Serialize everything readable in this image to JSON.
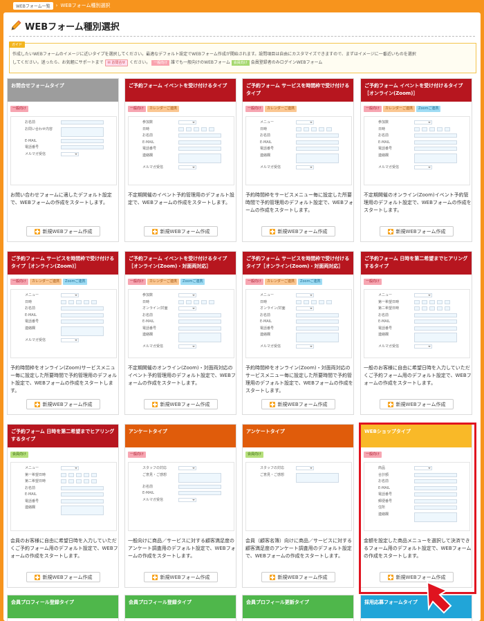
{
  "breadcrumb": {
    "home": "WEBフォーム一覧",
    "current": "WEBフォーム種別選択"
  },
  "page_title": "WEBフォーム種別選択",
  "guide": {
    "tag": "ガイド",
    "line1": "作成したいWEBフォームのイメージに近いタイプを選択してください。最適なデフォルト設定でWEBフォーム作成が開始されます。設問項目は自由にカスタマイズできますので、まずはイメージに一番近いものを選択",
    "line2a": "してください。迷ったら、お気軽にサポートまで",
    "contact_btn": "お問合せ",
    "line2b": "ください。",
    "tag_ippan": "一般向け",
    "line2c": "誰でも一般向けのWEBフォーム",
    "tag_kaiin": "会員向け",
    "line2d": "会員登録者のみログインWEBフォーム"
  },
  "new_btn_label": "新規WEBフォーム作成",
  "cards": [
    {
      "title": "お問合せフォームタイプ",
      "color": "#9d9d9d",
      "tags": [
        "一般向け"
      ],
      "fields": [
        [
          "お名前",
          "input"
        ],
        [
          "お問い合わせ内容",
          "box"
        ],
        [
          "E-MAIL",
          "input"
        ],
        [
          "電話番号",
          "input"
        ],
        [
          "メルマガ受信",
          "select"
        ]
      ],
      "desc": "お問い合わせフォームに適したデフォルト設定で、WEBフォームの作成をスタートします。"
    },
    {
      "title": "ご予約フォーム イベントを受け付けるタイプ",
      "color": "#b7161f",
      "tags": [
        "一般向け",
        "カレンダーご連携"
      ],
      "fields": [
        [
          "参加数",
          "select"
        ],
        [
          "日時",
          "date"
        ],
        [
          "お名前",
          "input"
        ],
        [
          "E-MAIL",
          "input"
        ],
        [
          "電話番号",
          "input"
        ],
        [
          "連絡欄",
          "box"
        ],
        [
          "メルマガ受信",
          "select"
        ]
      ],
      "desc": "不定期開催のイベント予約管理用のデフォルト設定で、WEBフォームの作成をスタートします。"
    },
    {
      "title": "ご予約フォーム サービスを時間枠で受け付けるタイプ",
      "color": "#b7161f",
      "tags": [
        "一般向け",
        "カレンダーご連携"
      ],
      "fields": [
        [
          "メニュー",
          "select"
        ],
        [
          "日時",
          "date"
        ],
        [
          "お名前",
          "input"
        ],
        [
          "E-MAIL",
          "input"
        ],
        [
          "電話番号",
          "input"
        ],
        [
          "連絡欄",
          "box"
        ],
        [
          "メルマガ受信",
          "select"
        ]
      ],
      "desc": "予約時間枠をサービスメニュー毎に設定した所要時間で予約管理用のデフォルト設定で、WEBフォームの作成をスタートします。"
    },
    {
      "title": "ご予約フォーム イベントを受け付けるタイプ［オンライン(Zoom)］",
      "color": "#b7161f",
      "tags": [
        "一般向け",
        "カレンダーご連携",
        "Zoomご連携"
      ],
      "fields": [
        [
          "参加数",
          "select"
        ],
        [
          "日時",
          "date"
        ],
        [
          "お名前",
          "input"
        ],
        [
          "E-MAIL",
          "input"
        ],
        [
          "電話番号",
          "input"
        ],
        [
          "連絡欄",
          "box"
        ],
        [
          "メルマガ受信",
          "select"
        ]
      ],
      "desc": "不定期開催のオンライン(Zoom)イベント予約管理用のデフォルト設定で、WEBフォームの作成をスタートします。"
    },
    {
      "title": "ご予約フォーム サービスを時間枠で受け付けるタイプ［オンライン(Zoom)］",
      "color": "#b7161f",
      "tags": [
        "一般向け",
        "カレンダーご連携",
        "Zoomご連携"
      ],
      "fields": [
        [
          "メニュー",
          "select"
        ],
        [
          "日時",
          "date"
        ],
        [
          "お名前",
          "input"
        ],
        [
          "E-MAIL",
          "input"
        ],
        [
          "電話番号",
          "input"
        ],
        [
          "連絡欄",
          "box"
        ],
        [
          "メルマガ受信",
          "select"
        ]
      ],
      "desc": "予約時間枠をオンライン(Zoom)サービスメニュー毎に設定した所要時間で予約管理用のデフォルト設定で、WEBフォームの作成をスタートします。"
    },
    {
      "title": "ご予約フォーム イベントを受け付けるタイプ［オンライン(Zoom)・対面両対応］",
      "color": "#b7161f",
      "tags": [
        "一般向け",
        "カレンダーご連携",
        "Zoomご連携"
      ],
      "fields": [
        [
          "参加数",
          "select"
        ],
        [
          "日時",
          "date"
        ],
        [
          "オンライン/対面",
          "select"
        ],
        [
          "お名前",
          "input"
        ],
        [
          "E-MAIL",
          "input"
        ],
        [
          "電話番号",
          "input"
        ],
        [
          "連絡欄",
          "box"
        ],
        [
          "メルマガ受信",
          "select"
        ]
      ],
      "desc": "不定期開催のオンライン(Zoom)・対面両対応のイベント予約管理用のデフォルト設定で、WEBフォームの作成をスタートします。"
    },
    {
      "title": "ご予約フォーム サービスを時間枠で受け付けるタイプ［オンライン(Zoom)・対面両対応］",
      "color": "#b7161f",
      "tags": [
        "一般向け",
        "カレンダーご連携",
        "Zoomご連携"
      ],
      "fields": [
        [
          "メニュー",
          "select"
        ],
        [
          "日時",
          "date"
        ],
        [
          "オンライン/対面",
          "select"
        ],
        [
          "お名前",
          "input"
        ],
        [
          "E-MAIL",
          "input"
        ],
        [
          "電話番号",
          "input"
        ],
        [
          "連絡欄",
          "box"
        ],
        [
          "メルマガ受信",
          "select"
        ]
      ],
      "desc": "予約時間枠をオンライン(Zoom)・対面両対応のサービスメニュー毎に設定した所要時間で予約管理用のデフォルト設定で、WEBフォームの作成をスタートします。"
    },
    {
      "title": "ご予約フォーム 日時を第二希望までヒアリングするタイプ",
      "color": "#b7161f",
      "tags": [
        "一般向け"
      ],
      "fields": [
        [
          "メニュー",
          "select"
        ],
        [
          "第一希望日時",
          "date"
        ],
        [
          "第二希望日時",
          "date"
        ],
        [
          "お名前",
          "input"
        ],
        [
          "E-MAIL",
          "input"
        ],
        [
          "電話番号",
          "input"
        ],
        [
          "連絡欄",
          "box"
        ],
        [
          "メルマガ受信",
          "select"
        ]
      ],
      "desc": "一般のお客様に自由に希望日時を入力していただくご予約フォーム用のデフォルト設定で、WEBフォームの作成をスタートします。"
    },
    {
      "title": "ご予約フォーム 日時を第二希望までヒアリングするタイプ",
      "color": "#b7161f",
      "tags": [
        "会員向け"
      ],
      "fields": [
        [
          "メニュー",
          "select"
        ],
        [
          "第一希望日時",
          "date"
        ],
        [
          "第二希望日時",
          "date"
        ],
        [
          "お名前",
          "input"
        ],
        [
          "E-MAIL",
          "input"
        ],
        [
          "電話番号",
          "input"
        ],
        [
          "連絡欄",
          "box"
        ]
      ],
      "desc": "会員のお客様に自由に希望日時を入力していただくご予約フォーム用のデフォルト設定で、WEBフォームの作成をスタートします。"
    },
    {
      "title": "アンケートタイプ",
      "color": "#e05c0b",
      "tags": [
        "一般向け"
      ],
      "fields": [
        [
          "スタッフの対応",
          "select"
        ],
        [
          "ご意見・ご感想",
          "box"
        ],
        [
          "お名前",
          "input"
        ],
        [
          "E-MAIL",
          "input"
        ],
        [
          "メルマガ受信",
          "select"
        ]
      ],
      "desc": "一般向けに商品／サービスに対する顧客満足度のアンケート調査用のデフォルト設定で、WEBフォームの作成をスタートします。"
    },
    {
      "title": "アンケートタイプ",
      "color": "#e05c0b",
      "tags": [
        "会員向け"
      ],
      "fields": [
        [
          "スタッフの対応",
          "select"
        ],
        [
          "ご意見・ご感想",
          "box"
        ]
      ],
      "desc": "会員（顧客名簿）向けに商品／サービスに対する顧客満足度のアンケート調査用のデフォルト設定で、WEBフォームの作成をスタートします。"
    },
    {
      "title": "WEBショップタイプ",
      "color": "#f9b928",
      "tags": [
        "一般向け"
      ],
      "fields": [
        [
          "商品",
          "select"
        ],
        [
          "合計額",
          "input"
        ],
        [
          "お名前",
          "input"
        ],
        [
          "E-MAIL",
          "input"
        ],
        [
          "電話番号",
          "input"
        ],
        [
          "郵便番号",
          "input"
        ],
        [
          "住所",
          "input"
        ],
        [
          "連絡欄",
          "box"
        ]
      ],
      "desc": "金額を設定した商品メニューを選択して決済できるフォーム用のデフォルト設定で、WEBフォームの作成をスタートします。"
    }
  ],
  "bottom_cards": [
    {
      "title": "会員プロフィール登録タイプ",
      "color": "#4fb74b"
    },
    {
      "title": "会員プロフィール登録タイプ",
      "color": "#4fb74b"
    },
    {
      "title": "会員プロフィール更新タイプ",
      "color": "#4fb74b"
    },
    {
      "title": "採用応募フォームタイプ",
      "color": "#21a5d8"
    }
  ]
}
